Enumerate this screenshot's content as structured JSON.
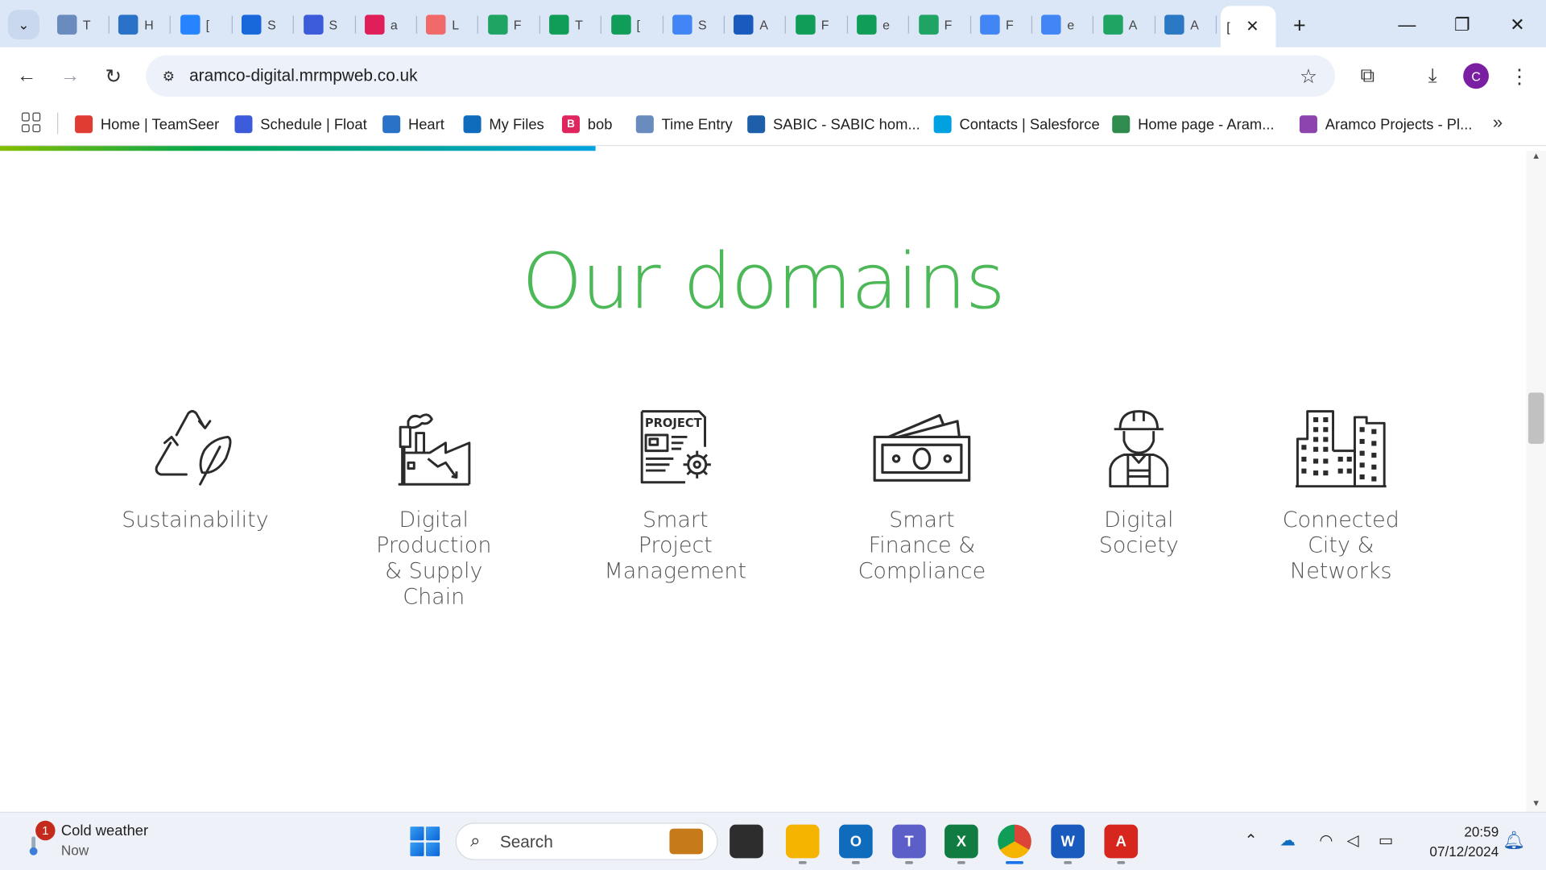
{
  "browser": {
    "tabs": [
      {
        "char": "T",
        "color": "#6a8bbd",
        "icon": "chart-icon"
      },
      {
        "char": "H",
        "color": "#2a72c8",
        "icon": "heart-flag-icon"
      },
      {
        "char": "[",
        "color": "#2684ff",
        "icon": "jira-icon"
      },
      {
        "char": "S",
        "color": "#1868db",
        "icon": "confluence-icon"
      },
      {
        "char": "S",
        "color": "#3b5bdb",
        "icon": "float-icon"
      },
      {
        "char": "a",
        "color": "#e01e5a",
        "icon": "slack-icon"
      },
      {
        "char": "L",
        "color": "#f06a6a",
        "icon": "asana-icon"
      },
      {
        "char": "F",
        "color": "#1fa463",
        "icon": "drive-icon"
      },
      {
        "char": "T",
        "color": "#0f9d58",
        "icon": "sheets-icon"
      },
      {
        "char": "[",
        "color": "#0f9d58",
        "icon": "sheets-icon"
      },
      {
        "char": "S",
        "color": "#4285f4",
        "icon": "docs-icon"
      },
      {
        "char": "A",
        "color": "#185abd",
        "icon": "word-icon"
      },
      {
        "char": "F",
        "color": "#0f9d58",
        "icon": "sheets-icon"
      },
      {
        "char": "e",
        "color": "#0f9d58",
        "icon": "sheets-icon"
      },
      {
        "char": "F",
        "color": "#1fa463",
        "icon": "drive-icon"
      },
      {
        "char": "F",
        "color": "#4285f4",
        "icon": "docs-icon"
      },
      {
        "char": "e",
        "color": "#4285f4",
        "icon": "docs-icon"
      },
      {
        "char": "A",
        "color": "#1fa463",
        "icon": "drive-icon"
      },
      {
        "char": "A",
        "color": "#2b78c5",
        "icon": "drupal-icon"
      }
    ],
    "active_tab": {
      "char": "[",
      "close": "✕"
    },
    "new_tab": "+",
    "url": "aramco-digital.mrmpweb.co.uk",
    "avatar_letter": "C"
  },
  "bookmarks": [
    {
      "label": "Home | TeamSeer",
      "color": "#e03c31",
      "icon": "teamseer-icon"
    },
    {
      "label": "Schedule | Float",
      "color": "#3b5bdb",
      "icon": "float-icon"
    },
    {
      "label": "Heart",
      "color": "#2a72c8",
      "icon": "heart-flag-icon"
    },
    {
      "label": "My Files",
      "color": "#0f6cbd",
      "icon": "onedrive-icon"
    },
    {
      "label": "bob",
      "color": "#e0245e",
      "icon": "bob-icon",
      "letter": "B"
    },
    {
      "label": "Time Entry",
      "color": "#6a8bbd",
      "icon": "time-entry-icon"
    },
    {
      "label": "SABIC - SABIC hom...",
      "color": "#1d5fa8",
      "icon": "sabic-icon"
    },
    {
      "label": "Contacts | Salesforce",
      "color": "#00a1e0",
      "icon": "salesforce-icon"
    },
    {
      "label": "Home page - Aram...",
      "color": "#2f8c4e",
      "icon": "aramco-home-icon"
    },
    {
      "label": "Aramco Projects - Pl...",
      "color": "#8e44ad",
      "icon": "planner-icon"
    }
  ],
  "page": {
    "heading": "Our domains",
    "heading_color": "#4cb857",
    "domains": [
      {
        "label": "Sustainability",
        "icon": "recycle-leaf-icon"
      },
      {
        "label": "Digital\nProduction\n& Supply\nChain",
        "icon": "factory-icon"
      },
      {
        "label": "Smart\nProject\nManagement",
        "icon": "project-document-icon"
      },
      {
        "label": "Smart\nFinance &\nCompliance",
        "icon": "banknote-icon"
      },
      {
        "label": "Digital\nSociety",
        "icon": "engineer-icon"
      },
      {
        "label": "Connected\nCity &\nNetworks",
        "icon": "city-buildings-icon"
      }
    ],
    "load_progress_percent": 38.5
  },
  "taskbar": {
    "weather_title": "Cold weather",
    "weather_sub": "Now",
    "weather_badge": "1",
    "search_placeholder": "Search",
    "time": "20:59",
    "date": "07/12/2024",
    "apps": [
      {
        "name": "task-view",
        "color": "#2d2d2d",
        "char": ""
      },
      {
        "name": "file-explorer",
        "color": "#f4b400",
        "char": ""
      },
      {
        "name": "outlook",
        "color": "#0f6cbd",
        "char": "O"
      },
      {
        "name": "teams",
        "color": "#5b5fc7",
        "char": "T"
      },
      {
        "name": "excel",
        "color": "#107c41",
        "char": "X"
      },
      {
        "name": "chrome",
        "color": "#ffffff",
        "char": ""
      },
      {
        "name": "word",
        "color": "#185abd",
        "char": "W"
      },
      {
        "name": "acrobat",
        "color": "#d7261e",
        "char": "A"
      }
    ]
  }
}
